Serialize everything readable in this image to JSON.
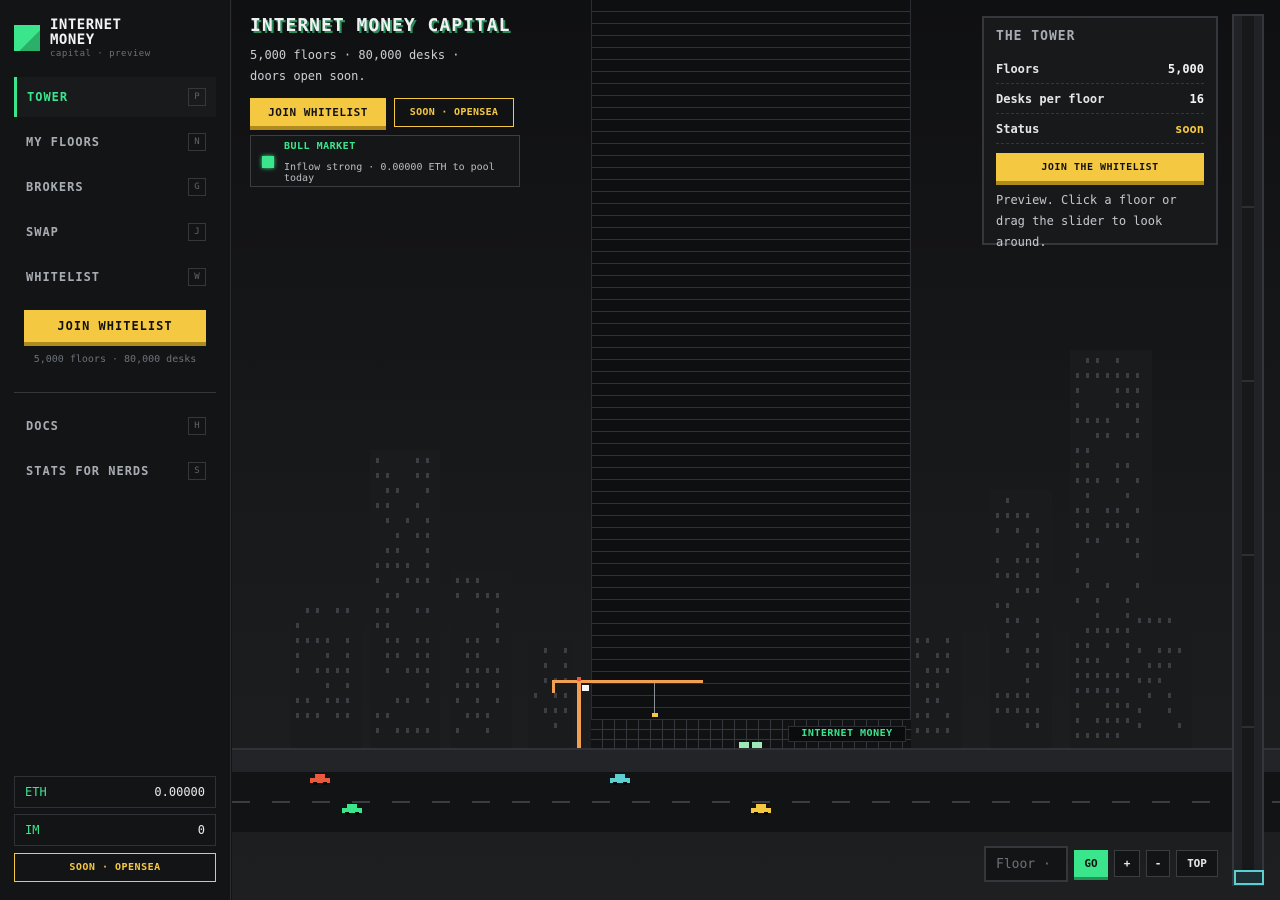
{
  "brand": {
    "title": "INTERNET MONEY",
    "subtitle": "capital · preview"
  },
  "nav": [
    {
      "label": "TOWER",
      "key": "P"
    },
    {
      "label": "MY FLOORS",
      "key": "N"
    },
    {
      "label": "BROKERS",
      "key": "G"
    },
    {
      "label": "SWAP",
      "key": "J"
    },
    {
      "label": "WHITELIST",
      "key": "W"
    }
  ],
  "nav_secondary": [
    {
      "label": "DOCS",
      "key": "H"
    },
    {
      "label": "STATS FOR NERDS",
      "key": "S"
    }
  ],
  "sidebar": {
    "join_label": "JOIN WHITELIST",
    "note": "5,000 floors · 80,000 desks",
    "opensea_label": "SOON · OPENSEA"
  },
  "wallet": {
    "eth": {
      "label": "ETH",
      "value": "0.00000"
    },
    "im": {
      "label": "IM",
      "value": "0"
    }
  },
  "hero": {
    "title": "INTERNET MONEY CAPITAL",
    "subtitle": "5,000 floors · 80,000 desks · doors open soon.",
    "join_label": "JOIN WHITELIST",
    "opensea_label": "SOON · OPENSEA",
    "market_title": "BULL MARKET",
    "market_text": "Inflow strong · 0.00000 ETH to pool today"
  },
  "tower_sign": "INTERNET MONEY",
  "panel": {
    "title": "THE TOWER",
    "rows": [
      {
        "label": "Floors",
        "value": "5,000"
      },
      {
        "label": "Desks per floor",
        "value": "16"
      },
      {
        "label": "Status",
        "value": "soon"
      }
    ],
    "join_label": "JOIN THE WHITELIST",
    "note": "Preview. Click a floor or drag the slider to look around."
  },
  "slider": {
    "position": 0
  },
  "controls": {
    "floor_placeholder": "Floor ·",
    "go_label": "GO",
    "plus_label": "+",
    "minus_label": "-",
    "top_label": "TOP"
  },
  "colors": {
    "accent_green": "#3be58c",
    "accent_yellow": "#f5c842",
    "crane_orange": "#f0a050",
    "background": "#131416"
  },
  "icons": {
    "logo": "logo-square-icon",
    "market_status": "status-dot-icon"
  }
}
